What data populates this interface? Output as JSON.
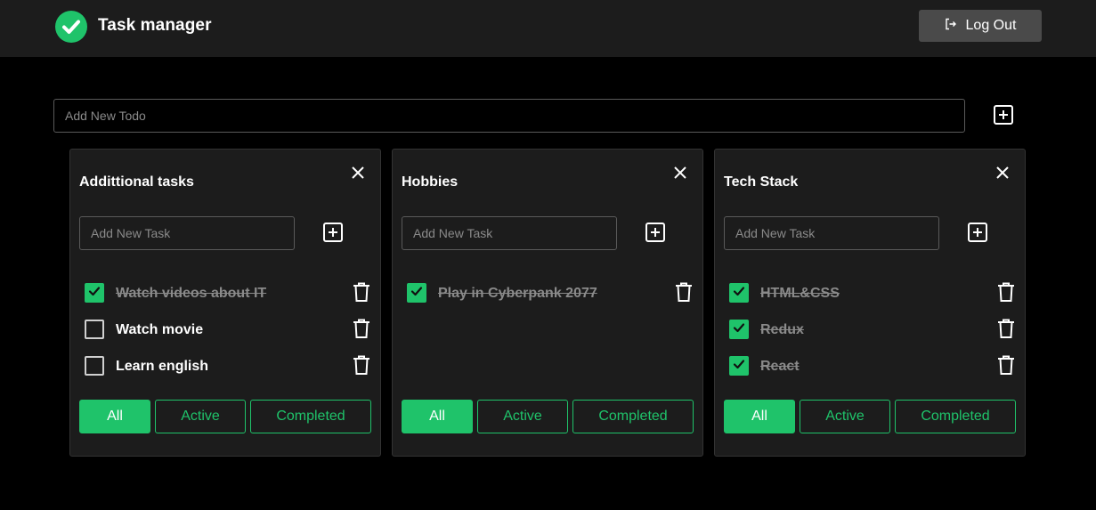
{
  "app": {
    "title": "Task manager",
    "logo_icon": "check-circle-icon"
  },
  "header": {
    "logout_label": "Log Out",
    "logout_icon": "logout-icon"
  },
  "new_todo": {
    "placeholder": "Add New Todo",
    "add_icon": "plus-square-icon"
  },
  "colors": {
    "accent": "#1fc36a",
    "card_bg": "#1c1c1c",
    "header_bg": "#1c1c1c"
  },
  "lists": [
    {
      "title": "Addittional tasks",
      "task_placeholder": "Add New Task",
      "tasks": [
        {
          "label": "Watch videos about IT",
          "done": true
        },
        {
          "label": "Watch movie",
          "done": false
        },
        {
          "label": "Learn english",
          "done": false
        }
      ],
      "filters": {
        "all": "All",
        "active": "Active",
        "completed": "Completed"
      },
      "selected_filter": "All"
    },
    {
      "title": "Hobbies",
      "task_placeholder": "Add New Task",
      "tasks": [
        {
          "label": "Play in Cyberpank 2077",
          "done": true
        }
      ],
      "filters": {
        "all": "All",
        "active": "Active",
        "completed": "Completed"
      },
      "selected_filter": "All"
    },
    {
      "title": "Tech Stack",
      "task_placeholder": "Add New Task",
      "tasks": [
        {
          "label": "HTML&CSS",
          "done": true
        },
        {
          "label": "Redux",
          "done": true
        },
        {
          "label": "React",
          "done": true
        }
      ],
      "filters": {
        "all": "All",
        "active": "Active",
        "completed": "Completed"
      },
      "selected_filter": "All"
    }
  ]
}
